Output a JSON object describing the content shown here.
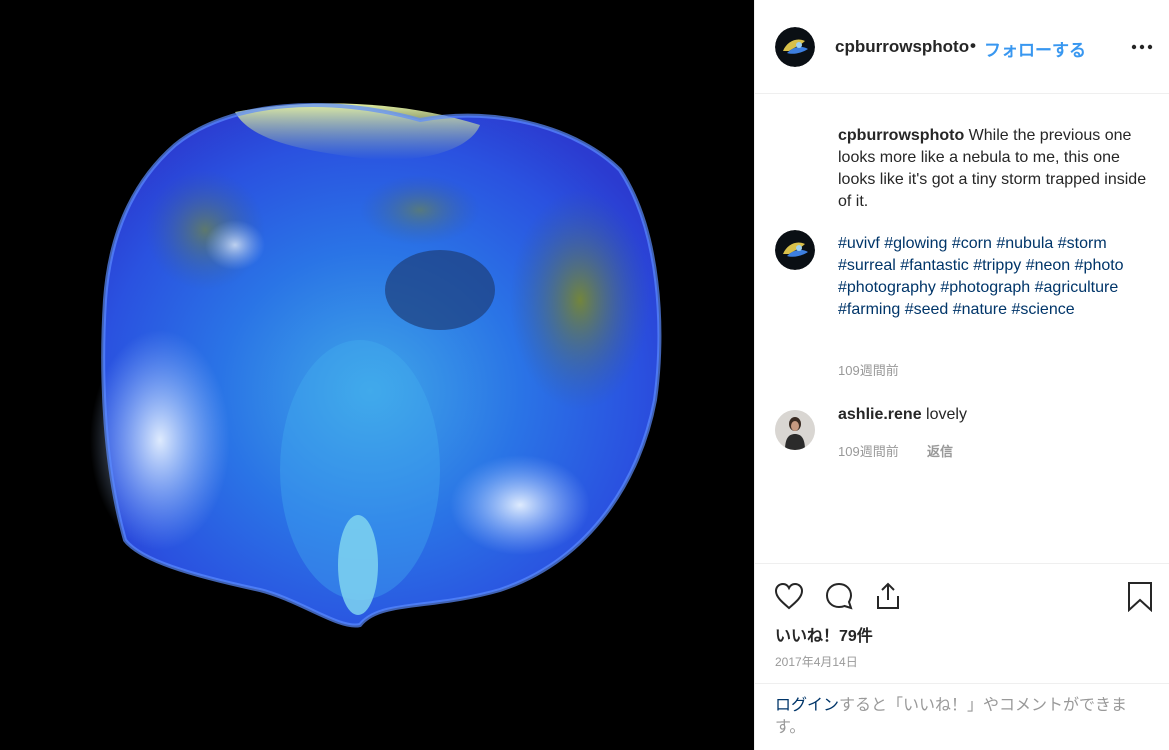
{
  "post": {
    "image_alt": "UV fluorescent corn seed cross-section glowing blue on black background"
  },
  "header": {
    "username": "cpburrowsphoto",
    "separator": "•",
    "follow_label": "フォローする",
    "more_icon": "more-horizontal-icon"
  },
  "caption": {
    "username": "cpburrowsphoto",
    "text": " While the previous one looks more like a nebula to me, this one looks like it's got a tiny storm trapped inside of it."
  },
  "hashtags": {
    "tags": [
      "#uvivf",
      "#glowing",
      "#corn",
      "#nubula",
      "#storm",
      "#surreal",
      "#fantastic",
      "#trippy",
      "#neon",
      "#photo",
      "#photography",
      "#photograph",
      "#agriculture",
      "#farming",
      "#seed",
      "#nature",
      "#science"
    ],
    "time": "109週間前"
  },
  "comment": {
    "username": "ashlie.rene",
    "text": " lovely",
    "time": "109週間前",
    "reply_label": "返信"
  },
  "actions": {
    "like_icon": "heart-icon",
    "comment_icon": "comment-bubble-icon",
    "share_icon": "share-icon",
    "save_icon": "bookmark-icon",
    "likes_text": "いいね！79件",
    "date": "2017年4月14日"
  },
  "login": {
    "link": "ログイン",
    "rest": "すると「いいね！」やコメントができます。"
  },
  "colors": {
    "link_blue": "#3897f0",
    "hashtag": "#003569",
    "muted": "#999999",
    "text": "#262626"
  }
}
